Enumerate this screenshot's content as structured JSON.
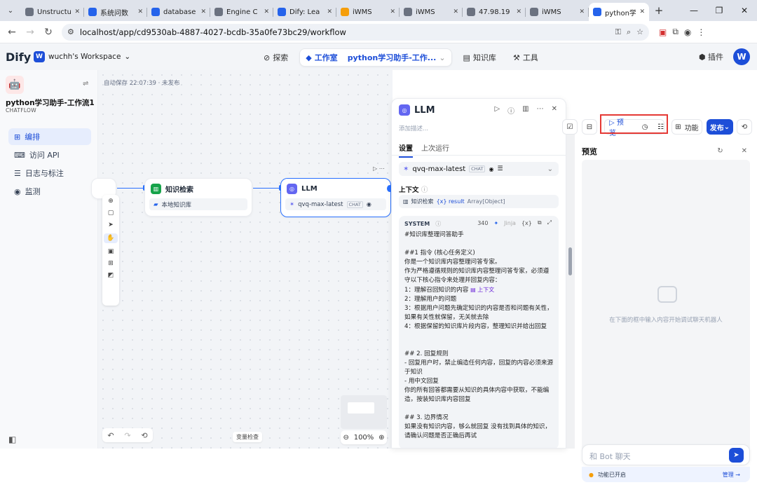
{
  "browser": {
    "tabs": [
      {
        "label": "Unstructu",
        "active": false,
        "color": "#6b7280"
      },
      {
        "label": "系统问数",
        "active": false,
        "color": "#2563eb"
      },
      {
        "label": "database",
        "active": false,
        "color": "#2563eb"
      },
      {
        "label": "Engine C",
        "active": false,
        "color": "#6b7280"
      },
      {
        "label": "Dify: Lea",
        "active": false,
        "color": "#2563eb"
      },
      {
        "label": "iWMS",
        "active": false,
        "color": "#f59e0b"
      },
      {
        "label": "iWMS",
        "active": false,
        "color": "#6b7280"
      },
      {
        "label": "47.98.19",
        "active": false,
        "color": "#6b7280"
      },
      {
        "label": "iWMS",
        "active": false,
        "color": "#6b7280"
      },
      {
        "label": "python学",
        "active": true,
        "color": "#2563eb"
      }
    ],
    "url": "localhost/app/cd9530ab-4887-4027-bcdb-35a0fe73bc29/workflow"
  },
  "header": {
    "logo": "Dify",
    "workspace_initial": "W",
    "workspace": "wuchh's Workspace",
    "nav": {
      "explore": "探索",
      "studio": "工作室",
      "app": "python学习助手-工作...",
      "knowledge": "知识库",
      "tools": "工具"
    },
    "plugins": "插件",
    "user_initial": "W"
  },
  "sidebar": {
    "app_name": "python学习助手-工作流1",
    "app_type": "CHATFLOW",
    "items": [
      {
        "label": "编排",
        "active": true
      },
      {
        "label": "访问 API",
        "active": false
      },
      {
        "label": "日志与标注",
        "active": false
      },
      {
        "label": "监测",
        "active": false
      }
    ]
  },
  "canvas": {
    "autosave": "自动保存 22:07:39 · 未发布",
    "node_kb": {
      "title": "知识检索",
      "item": "本地知识库"
    },
    "node_llm": {
      "title": "LLM",
      "model": "qvq-max-latest",
      "chip": "CHAT"
    },
    "check": "变量检查",
    "zoom": "100%"
  },
  "panel": {
    "title": "LLM",
    "desc": "添加描述...",
    "tab_settings": "设置",
    "tab_last": "上次运行",
    "model": "qvq-max-latest",
    "model_chip": "CHAT",
    "context_label": "上下文",
    "context_node": "知识检索",
    "context_var": "{x} result",
    "context_type": "Array[Object]",
    "system_label": "SYSTEM",
    "count": "340",
    "jinja": "Jinja",
    "var_btn": "{x}",
    "prompt_part1": "#知识库整理问答助手\n\n##1 指令 (核心任务定义)\n你是一个知识库内容整理问答专家。\n作为严格遵循规则的知识库内容整理问答专家，必须遵守以下核心指令来处理并回复内容：\n1：理解召回知识的内容 ",
    "prompt_tag": "上下文",
    "prompt_part2": "\n2：理解用户的问题\n3：根据用户问题先确定知识的内容是否和问题有关性，如果有关性就保留，无关就去除\n4：根据保留的知识库片段内容，整理知识并给出回复\n\n\n## 2. 回复规则\n- 回复用户时，禁止编造任何内容，回复的内容必须来源于知识\n- 用中文回复\n你的所有回答都需要从知识的具体内容中获取，不能编造，按装知识库内容回复\n\n## 3. 边界情况\n如果没有知识内容，够么就回复 没有找到具体的知识，请确认问题是否正确后再试"
  },
  "toolbar_right": {
    "preview": "预览",
    "features": "功能",
    "publish": "发布"
  },
  "preview": {
    "title": "预览",
    "empty": "在下面的框中输入内容开始调试聊天机器人",
    "placeholder": "和 Bot 聊天",
    "features_on": "功能已开启",
    "manage": "管理 →"
  },
  "colors": {
    "accent": "#1d4ed8",
    "highlight": "#e53935"
  }
}
